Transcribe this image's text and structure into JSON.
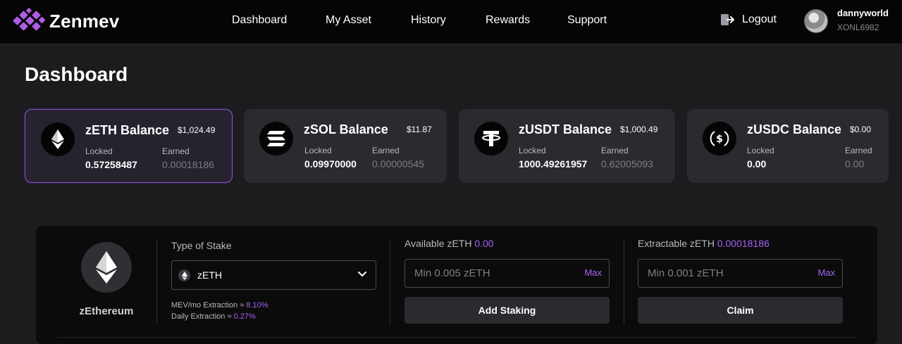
{
  "header": {
    "brand": "Zenmev",
    "nav": [
      {
        "label": "Dashboard"
      },
      {
        "label": "My Asset"
      },
      {
        "label": "History"
      },
      {
        "label": "Rewards"
      },
      {
        "label": "Support"
      }
    ],
    "logout_label": "Logout",
    "user": {
      "name": "dannyworld",
      "id": "XONL6982"
    }
  },
  "page_title": "Dashboard",
  "cards": [
    {
      "title": "zETH Balance",
      "amount": "$1,024.49",
      "locked_label": "Locked",
      "locked": "0.57258487",
      "earned_label": "Earned",
      "earned": "0.00018186",
      "icon": "ethereum-icon"
    },
    {
      "title": "zSOL Balance",
      "amount": "$11.87",
      "locked_label": "Locked",
      "locked": "0.09970000",
      "earned_label": "Earned",
      "earned": "0.00000545",
      "icon": "solana-icon"
    },
    {
      "title": "zUSDT Balance",
      "amount": "$1,000.49",
      "locked_label": "Locked",
      "locked": "1000.49261957",
      "earned_label": "Earned",
      "earned": "0.62005093",
      "icon": "tether-icon"
    },
    {
      "title": "zUSDC Balance",
      "amount": "$0.00",
      "locked_label": "Locked",
      "locked": "0.00",
      "earned_label": "Earned",
      "earned": "0.00",
      "icon": "usdc-icon"
    }
  ],
  "stake": {
    "coin_name": "zEthereum",
    "type_label": "Type of Stake",
    "selected": "zETH",
    "mev_label": "MEV/mo Extraction ≈",
    "mev_value": "8.10%",
    "daily_label": "Daily Extraction ≈",
    "daily_value": "0.27%",
    "available_label": "Available zETH",
    "available_value": "0.00",
    "stake_placeholder": "Min 0.005 zETH",
    "max_label": "Max",
    "add_button": "Add Staking",
    "extractable_label": "Extractable zETH",
    "extractable_value": "0.00018186",
    "claim_placeholder": "Min 0.001 zETH",
    "claim_button": "Claim"
  },
  "colors": {
    "accent": "#a463f0",
    "brand": "#b05ce6",
    "header_bg": "#050505",
    "card_bg": "#2a2a2f"
  }
}
